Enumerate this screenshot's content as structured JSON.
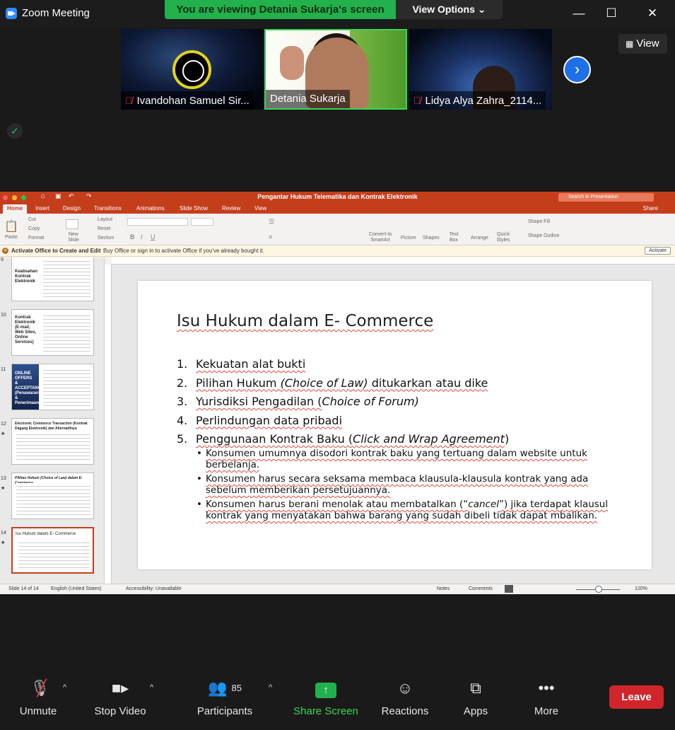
{
  "window": {
    "title": "Zoom Meeting",
    "banner": "You are viewing Detania Sukarja's screen",
    "view_options": "View Options ⌄"
  },
  "participants_strip": {
    "tiles": [
      {
        "name": "Ivandohan Samuel Sir..."
      },
      {
        "name": "Detania Sukarja"
      },
      {
        "name": "Lidya Alya Zahra_2114..."
      }
    ],
    "view_label": "View"
  },
  "ppt": {
    "doc_title": "Pengantar Hukum Telematika dan Kontrak Elektronik",
    "search_placeholder": "Search in Presentation",
    "share_label": "Share",
    "tabs": [
      "Home",
      "Insert",
      "Design",
      "Transitions",
      "Animations",
      "Slide Show",
      "Review",
      "View"
    ],
    "ribbon": {
      "paste": "Paste",
      "cut": "Cut",
      "copy": "Copy",
      "format": "Format",
      "new_slide": "New Slide",
      "layout": "Layout",
      "reset": "Reset",
      "section": "Section",
      "convert": "Convert to SmartArt",
      "picture": "Picture",
      "shapes": "Shapes",
      "textbox": "Text Box",
      "arrange": "Arrange",
      "quick_styles": "Quick Styles",
      "shape_fill": "Shape Fill",
      "shape_outline": "Shape Outline"
    },
    "activate_bar": {
      "title": "Activate Office to Create and Edit",
      "message": "Buy Office or sign in to activate Office if you've already bought it.",
      "button": "Activate"
    },
    "thumbnails": [
      {
        "num": "9",
        "title": "Keabsahan Kontrak Elektronik"
      },
      {
        "num": "10",
        "title": "Kontrak Elektronik (E-mail, Web Sites, Online Services)"
      },
      {
        "num": "11",
        "title": "ONLINE OFFERS & ACCEPTANCES (Penawaran & Penerimaan)"
      },
      {
        "num": "12",
        "title": "Electronic Commerce Transaction (Kontrak Dagang Elektronik) dan Alternatifnya"
      },
      {
        "num": "13",
        "title": "Pilihan Hukum (Choice of Law) dalam E- Commerce"
      },
      {
        "num": "14",
        "title": "Isu Hukum dalam E- Commerce"
      }
    ],
    "slide": {
      "title": "Isu Hukum dalam E- Commerce",
      "items": [
        {
          "n": "1.",
          "text": "Kekuatan alat bukti"
        },
        {
          "n": "2.",
          "pre": "Pilihan Hukum ",
          "em": "(Choice of Law)",
          "post": " ditukarkan atau dike"
        },
        {
          "n": "3.",
          "pre": "Yurisdiksi Pengadilan (",
          "em": "Choice of Forum)",
          "post": ""
        },
        {
          "n": "4.",
          "text": "Perlindungan data pribadi"
        },
        {
          "n": "5.",
          "pre": "Penggunaan Kontrak Baku (",
          "em": "Click and Wrap Agreement",
          "post": ")"
        }
      ],
      "bullets": [
        {
          "text": "Konsumen umumnya disodori kontrak baku yang tertuang dalam website untuk berbelanja."
        },
        {
          "text": "Konsumen harus secara seksama membaca klausula-klausula kontrak yang ada sebelum memberikan persetujuannya."
        },
        {
          "pre": "Konsumen harus berani menolak atau membatalkan (“",
          "em": "cancel",
          "post": "”) jika terdapat klausul kontrak yang menyatakan bahwa barang yang sudah dibeli tidak dapat mbalikan."
        }
      ]
    },
    "status": {
      "slide_of": "Slide 14 of 14",
      "language": "English (United States)",
      "accessibility": "Accessibility: Unavailable",
      "notes": "Notes",
      "comments": "Comments",
      "zoom": "120%"
    }
  },
  "toolbar": {
    "unmute": "Unmute",
    "stop_video": "Stop Video",
    "participants": "Participants",
    "participants_count": "85",
    "share_screen": "Share Screen",
    "reactions": "Reactions",
    "apps": "Apps",
    "more": "More",
    "leave": "Leave"
  },
  "colors": {
    "share_green": "#22b14c",
    "ppt_orange": "#c43e1c",
    "leave_red": "#d0262b",
    "zoom_blue": "#2d8cff"
  }
}
